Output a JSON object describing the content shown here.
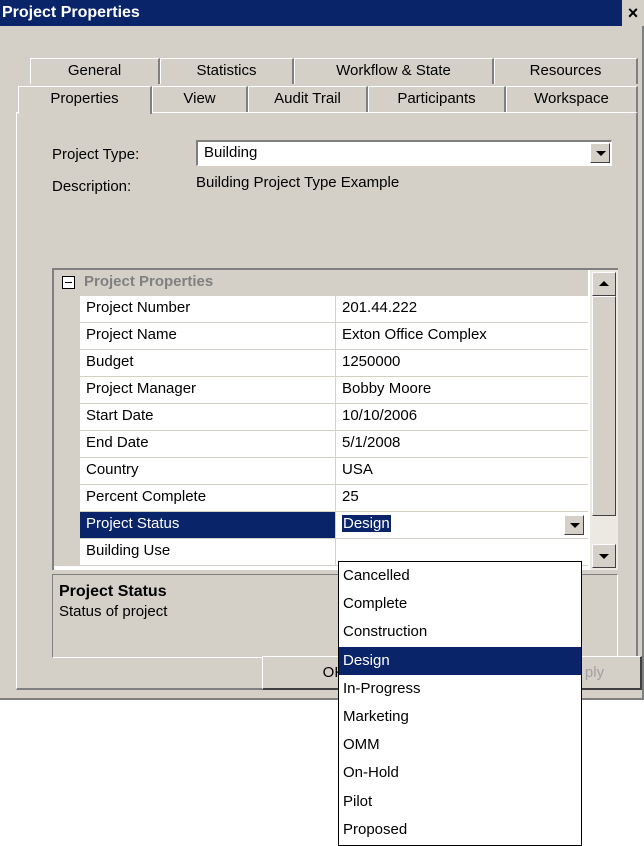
{
  "window": {
    "title": "Project Properties",
    "close_glyph": "×"
  },
  "tabs": {
    "row1": [
      "General",
      "Statistics",
      "Workflow & State",
      "Resources"
    ],
    "row2": [
      "Properties",
      "View",
      "Audit Trail",
      "Participants",
      "Workspace"
    ],
    "active": "Properties"
  },
  "form": {
    "project_type_label": "Project Type:",
    "project_type_value": "Building",
    "description_label": "Description:",
    "description_value": "Building Project Type Example"
  },
  "grid": {
    "section_title": "Project Properties",
    "rows": [
      {
        "name": "Project Number",
        "value": "201.44.222"
      },
      {
        "name": "Project Name",
        "value": "Exton Office Complex"
      },
      {
        "name": "Budget",
        "value": "1250000"
      },
      {
        "name": "Project Manager",
        "value": "Bobby Moore"
      },
      {
        "name": "Start Date",
        "value": "10/10/2006"
      },
      {
        "name": "End Date",
        "value": "5/1/2008"
      },
      {
        "name": "Country",
        "value": "USA"
      },
      {
        "name": "Percent Complete",
        "value": "25"
      },
      {
        "name": "Project Status",
        "value": "Design"
      },
      {
        "name": "Building Use",
        "value": ""
      }
    ],
    "selected_row": "Project Status"
  },
  "help": {
    "title": "Project Status",
    "text": "Status of project"
  },
  "status_dropdown": {
    "options": [
      "Cancelled",
      "Complete",
      "Construction",
      "Design",
      "In-Progress",
      "Marketing",
      "OMM",
      "On-Hold",
      "Pilot",
      "Proposed"
    ],
    "highlighted": "Design"
  },
  "buttons": {
    "ok": "OK",
    "apply_visible": "ply"
  },
  "colors": {
    "titlebar": "#0a246a",
    "selection": "#0a246a",
    "dialog_face": "#d4d0c8"
  }
}
